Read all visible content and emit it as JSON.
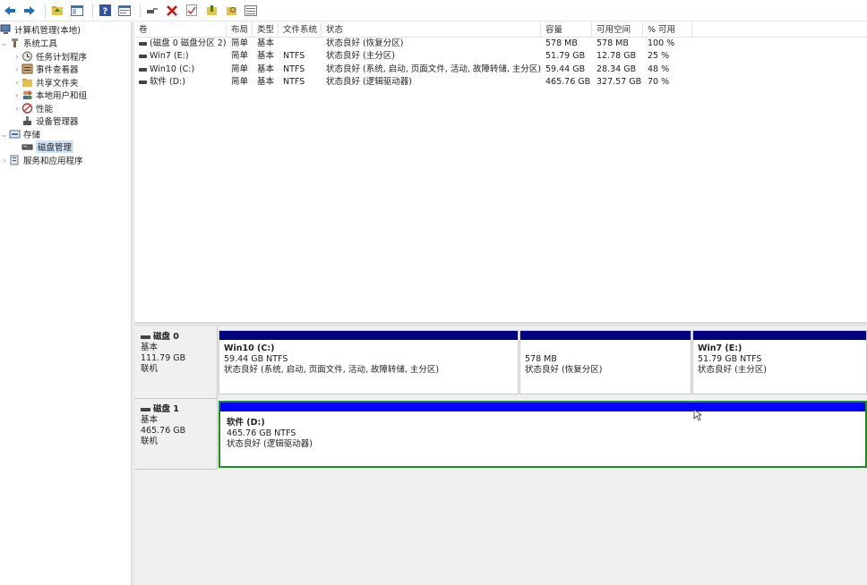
{
  "colors": {
    "primary_bar": "#000080",
    "logical_bar": "#0000ff",
    "logical_border": "#1e8c1e",
    "selection": "#cce4f7"
  },
  "toolbar": {
    "buttons": [
      "back-arrow-icon",
      "forward-arrow-icon",
      "up-folder-icon",
      "console-tree-icon",
      "help-icon",
      "properties-icon",
      "connect-icon",
      "delete-icon",
      "check-icon",
      "new-volume-icon",
      "search-folder-icon",
      "view-icon"
    ]
  },
  "tree": {
    "root": "计算机管理(本地)",
    "system_tools": "系统工具",
    "task_scheduler": "任务计划程序",
    "event_viewer": "事件查看器",
    "shared_folders": "共享文件夹",
    "local_users": "本地用户和组",
    "performance": "性能",
    "device_manager": "设备管理器",
    "storage": "存储",
    "disk_management": "磁盘管理",
    "services_apps": "服务和应用程序"
  },
  "volume_list": {
    "headers": {
      "volume": "卷",
      "layout": "布局",
      "type": "类型",
      "fs": "文件系统",
      "status": "状态",
      "capacity": "容量",
      "free": "可用空间",
      "pct": "% 可用"
    },
    "rows": [
      {
        "volume": "(磁盘 0 磁盘分区 2)",
        "layout": "简单",
        "type": "基本",
        "fs": "",
        "status": "状态良好 (恢复分区)",
        "capacity": "578 MB",
        "free": "578 MB",
        "pct": "100 %"
      },
      {
        "volume": "Win7 (E:)",
        "layout": "简单",
        "type": "基本",
        "fs": "NTFS",
        "status": "状态良好 (主分区)",
        "capacity": "51.79 GB",
        "free": "12.78 GB",
        "pct": "25 %"
      },
      {
        "volume": "Win10 (C:)",
        "layout": "简单",
        "type": "基本",
        "fs": "NTFS",
        "status": "状态良好 (系统, 启动, 页面文件, 活动, 故障转储, 主分区)",
        "capacity": "59.44 GB",
        "free": "28.34 GB",
        "pct": "48 %"
      },
      {
        "volume": "软件 (D:)",
        "layout": "简单",
        "type": "基本",
        "fs": "NTFS",
        "status": "状态良好 (逻辑驱动器)",
        "capacity": "465.76 GB",
        "free": "327.57 GB",
        "pct": "70 %"
      }
    ]
  },
  "disks": [
    {
      "name": "磁盘 0",
      "type": "基本",
      "size": "111.79 GB",
      "state": "联机",
      "partitions": [
        {
          "title": "Win10  (C:)",
          "size": "59.44 GB NTFS",
          "status": "状态良好 (系统, 启动, 页面文件, 活动, 故障转储, 主分区)"
        },
        {
          "title": "",
          "size": "578 MB",
          "status": "状态良好 (恢复分区)"
        },
        {
          "title": "Win7  (E:)",
          "size": "51.79 GB NTFS",
          "status": "状态良好 (主分区)"
        }
      ]
    },
    {
      "name": "磁盘 1",
      "type": "基本",
      "size": "465.76 GB",
      "state": "联机",
      "partitions": [
        {
          "title": "软件  (D:)",
          "size": "465.76 GB NTFS",
          "status": "状态良好 (逻辑驱动器)"
        }
      ]
    }
  ]
}
